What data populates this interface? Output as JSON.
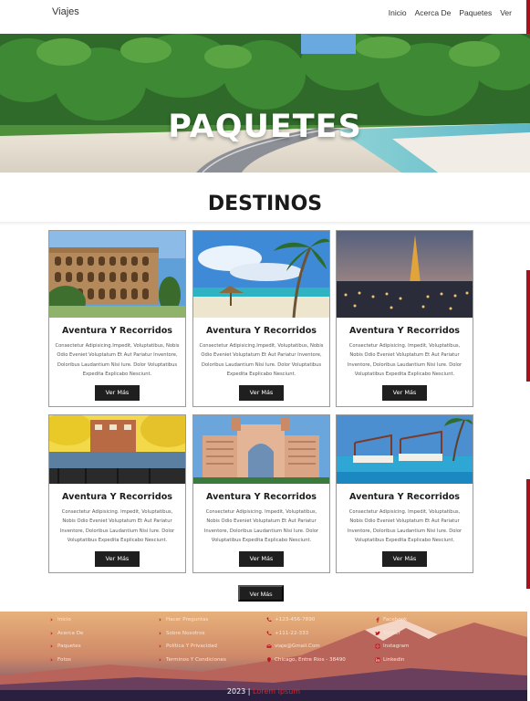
{
  "brand": "Viajes",
  "nav": [
    "Inicio",
    "Acerca De",
    "Paquetes",
    "Ver"
  ],
  "hero_title": "PAQUETES",
  "section_title": "DESTINOS",
  "cards": [
    {
      "title": "Aventura Y Recorridos",
      "text": "Consectetur Adipisicing.Impedit, Voluptatibus, Nobis Odio Eveniet Voluptatum Et Aut Pariatur Inventore, Doloribus Laudantium Nisi Iure. Dolor Voluptatibus Expedita Explicabo Nesciunt.",
      "button": "Ver Más",
      "image": "colosseum"
    },
    {
      "title": "Aventura Y Recorridos",
      "text": "Consectetur Adipisicing.Impedit, Voluptatibus, Nobis Odio Eveniet Voluptatum Et Aut Pariatur Inventore, Doloribus Laudantium Nisi Iure. Dolor Voluptatibus Expedita Explicabo Nesciunt.",
      "button": "Ver Más",
      "image": "beach"
    },
    {
      "title": "Aventura Y Recorridos",
      "text": "Consectetur Adipisicing. Impedit, Voluptatibus, Nobis Odio Eveniet Voluptatum Et Aut Pariatur Inventore, Doloribus Laudantium Nisi Iure. Dolor Voluptatibus Expedita Explicabo Nesciunt.",
      "button": "Ver Más",
      "image": "eiffel"
    },
    {
      "title": "Aventura Y Recorridos",
      "text": "Consectetur Adipisicing. Impedit, Voluptatibus, Nobis Odio Eveniet Voluptatum Et Aut Pariatur Inventore, Doloribus Laudantium Nisi Iure. Dolor Voluptatibus Expedita Explicabo Nesciunt.",
      "button": "Ver Más",
      "image": "canal"
    },
    {
      "title": "Aventura Y Recorridos",
      "text": "Consectetur Adipisicing. Impedit, Voluptatibus, Nobis Odio Eveniet Voluptatum Et Aut Pariatur Inventore, Doloribus Laudantium Nisi Iure. Dolor Voluptatibus Expedita Explicabo Nesciunt.",
      "button": "Ver Más",
      "image": "atlantis"
    },
    {
      "title": "Aventura Y Recorridos",
      "text": "Consectetur Adipisicing. Impedit, Voluptatibus, Nobis Odio Eveniet Voluptatum Et Aut Pariatur Inventore, Doloribus Laudantium Nisi Iure. Dolor Voluptatibus Expedita Explicabo Nesciunt.",
      "button": "Ver Más",
      "image": "resort"
    }
  ],
  "more_button": "Ver Más",
  "footer": {
    "col1": [
      "Inicio",
      "Acerca De",
      "Paquetes",
      "Fotos"
    ],
    "col2": [
      "Hacer Preguntas",
      "Sobre Nosotros",
      "Política Y Privacidad",
      "Terminos Y Condiciones"
    ],
    "col3": [
      {
        "icon": "phone-icon",
        "text": "+123-456-7890"
      },
      {
        "icon": "phone-icon",
        "text": "+111-22-333"
      },
      {
        "icon": "email-icon",
        "text": "viaje@Gmail.Com"
      },
      {
        "icon": "location-icon",
        "text": "Chicago, Entre Rios - 38490"
      }
    ],
    "col4": [
      {
        "icon": "facebook-icon",
        "text": "Facebook"
      },
      {
        "icon": "twitter-icon",
        "text": "Twitter"
      },
      {
        "icon": "instagram-icon",
        "text": "Instagram"
      },
      {
        "icon": "linkedin-icon",
        "text": "Linkedin"
      }
    ],
    "copyright_year": "2023 |",
    "copyright_name": "Lorem Ipsum"
  },
  "colors": {
    "accent": "#c0161f",
    "dark_button": "#1f1f1f"
  }
}
